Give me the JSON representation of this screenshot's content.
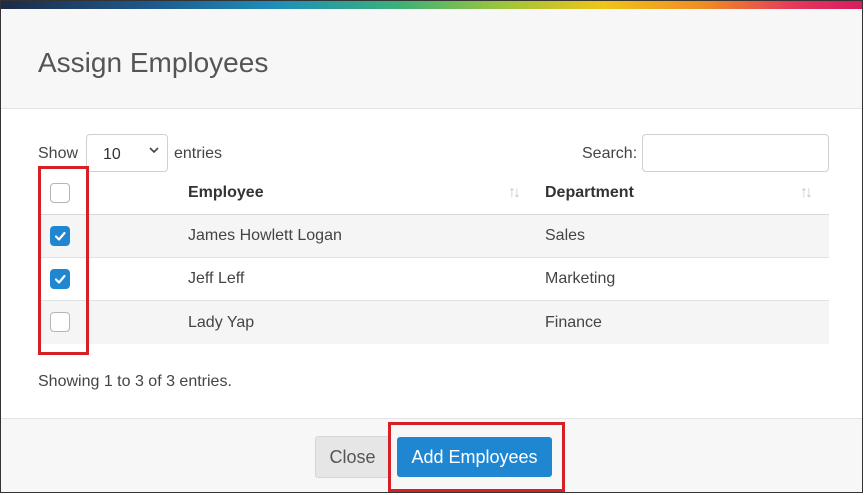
{
  "dialog": {
    "title": "Assign Employees"
  },
  "controls": {
    "show_label": "Show",
    "page_length": "10",
    "entries_label": "entries",
    "search_label": "Search:",
    "search_value": ""
  },
  "table": {
    "columns": [
      "Employee",
      "Department"
    ],
    "header_checkbox_checked": false,
    "rows": [
      {
        "employee": "James Howlett Logan",
        "department": "Sales",
        "checked": true
      },
      {
        "employee": "Jeff Leff",
        "department": "Marketing",
        "checked": true
      },
      {
        "employee": "Lady Yap",
        "department": "Finance",
        "checked": false
      }
    ]
  },
  "info": "Showing 1 to 3 of 3 entries.",
  "footer": {
    "close_label": "Close",
    "add_label": "Add Employees"
  },
  "colors": {
    "accent": "#1f87d1",
    "highlight": "#d61f26"
  }
}
